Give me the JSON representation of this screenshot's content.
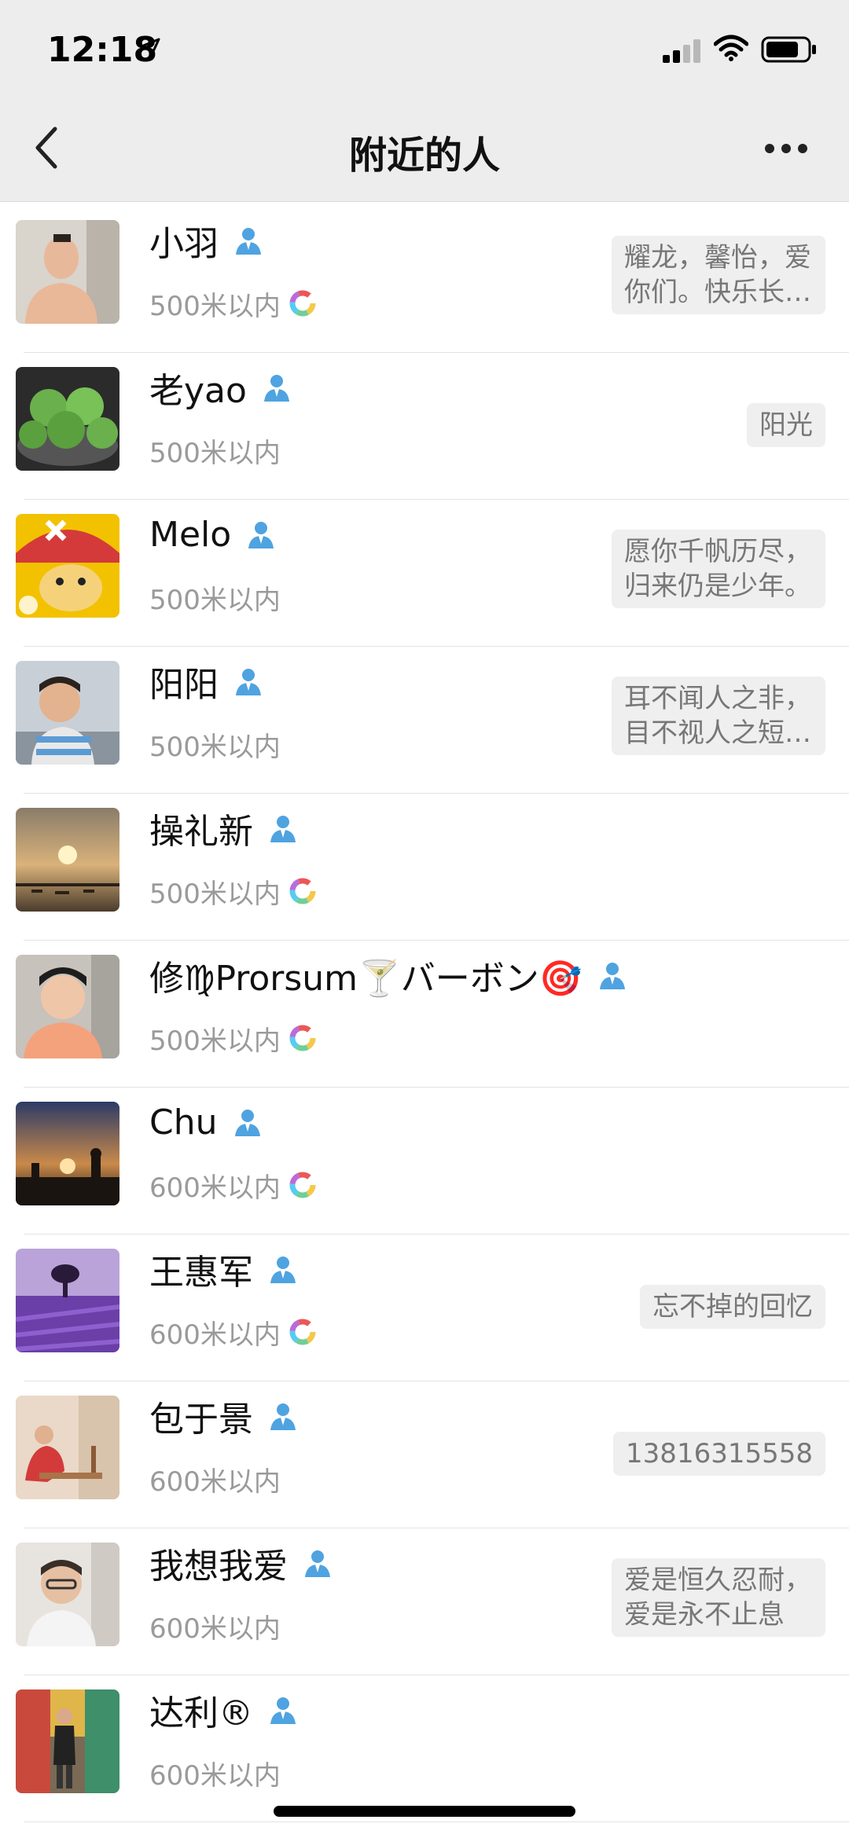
{
  "status_bar": {
    "time": "12:18"
  },
  "nav": {
    "title": "附近的人"
  },
  "people": [
    {
      "name": "小羽",
      "distance": "500米以内",
      "ring": true,
      "signature": "耀龙，馨怡，爱\n你们。快乐长…"
    },
    {
      "name": "老yao",
      "distance": "500米以内",
      "ring": false,
      "signature": "阳光"
    },
    {
      "name": "Melo",
      "distance": "500米以内",
      "ring": false,
      "signature": "愿你千帆历尽，\n归来仍是少年。"
    },
    {
      "name": "阳阳",
      "distance": "500米以内",
      "ring": false,
      "signature": "耳不闻人之非，\n目不视人之短…"
    },
    {
      "name": "操礼新",
      "distance": "500米以内",
      "ring": true,
      "signature": ""
    },
    {
      "name": "修♍Prorsum🍸バーボン🎯",
      "distance": "500米以内",
      "ring": true,
      "signature": ""
    },
    {
      "name": "Chu",
      "distance": "600米以内",
      "ring": true,
      "signature": ""
    },
    {
      "name": "王惠军",
      "distance": "600米以内",
      "ring": true,
      "signature": "忘不掉的回忆"
    },
    {
      "name": "包于景",
      "distance": "600米以内",
      "ring": false,
      "signature": "13816315558"
    },
    {
      "name": "我想我爱",
      "distance": "600米以内",
      "ring": false,
      "signature": "爱是恒久忍耐，\n爱是永不止息"
    },
    {
      "name": "达利®",
      "distance": "600米以内",
      "ring": false,
      "signature": ""
    }
  ],
  "colors": {
    "nav_bg": "#ededed",
    "accent_person_icon": "#4fa3e0",
    "distance_text": "#9a9a9a"
  }
}
